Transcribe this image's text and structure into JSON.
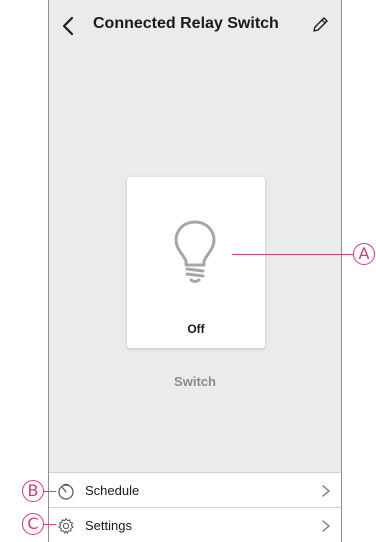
{
  "header": {
    "title": "Connected Relay Switch",
    "back_icon": "chevron-left-icon",
    "edit_icon": "pencil-icon"
  },
  "device": {
    "icon": "lightbulb-icon",
    "state": "Off",
    "label": "Switch"
  },
  "menu": {
    "items": [
      {
        "label": "Schedule",
        "icon": "timer-icon"
      },
      {
        "label": "Settings",
        "icon": "gear-icon"
      }
    ]
  },
  "callouts": {
    "a": "A",
    "b": "B",
    "c": "C"
  },
  "colors": {
    "background": "#ebebeb",
    "callout": "#d63a7a"
  }
}
